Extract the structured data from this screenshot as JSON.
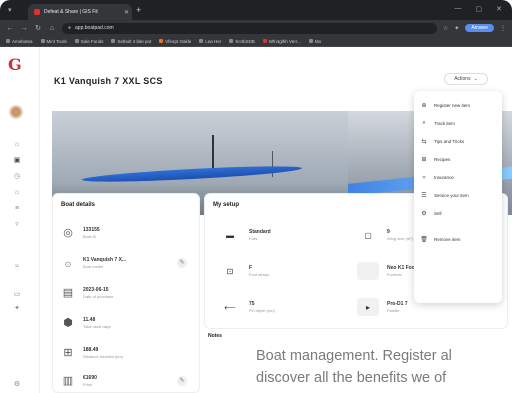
{
  "browser": {
    "tab_title": "Defeat & Share | GIS Fit",
    "url": "app.boatpad.com",
    "profile_label": "Amwee",
    "bookmarks": [
      "Amebotea",
      "Mint Tools",
      "Sole Funds",
      "Setbolt 4 bite pot",
      "Vfinrpt Oakle",
      "Lea Her",
      "ScrtkSDB",
      "Wfn4glhh Verr...",
      "Mo"
    ]
  },
  "sidebar": {
    "brand_logo": "G",
    "nav_icons": [
      "home-icon",
      "board-icon",
      "clock-icon",
      "bag-icon",
      "list-icon",
      "filter-icon",
      "wave-icon",
      "chat-icon",
      "star-icon",
      "settings-icon"
    ]
  },
  "page": {
    "title": "K1 Vanquish 7 XXL SCS",
    "actions_label": "Actions"
  },
  "boat_details": {
    "title": "Boat details",
    "rows": [
      {
        "icon": "gauge-icon",
        "value": "133155",
        "sub": "Boat ID"
      },
      {
        "icon": "fingerprint-icon",
        "value": "K1 Vanquish 7 X...",
        "sub": "Boat model"
      },
      {
        "icon": "calendar-icon",
        "value": "2023-06-15",
        "sub": "Date of purchase"
      },
      {
        "icon": "shield-icon",
        "value": "11.48",
        "sub": "Total used days"
      },
      {
        "icon": "ruler-icon",
        "value": "188.49",
        "sub": "Distance traveled (km)"
      },
      {
        "icon": "receipt-icon",
        "value": "€1690",
        "sub": "Price"
      }
    ]
  },
  "my_setup": {
    "title": "My setup",
    "items": [
      {
        "value": "Standard",
        "sub": "Foils",
        "color": "#ffffff"
      },
      {
        "value": "9",
        "sub": "Wing size (m²)",
        "color": "#ffffff"
      },
      {
        "value": "F",
        "sub": "Foot straps",
        "color": "#ffffff"
      },
      {
        "value": "Neo K1 Footrest with Car...",
        "sub": "Footrest",
        "color": "#f1f1f1"
      },
      {
        "value": "75",
        "sub": "Fin depth (cm)",
        "color": "#ffffff"
      },
      {
        "value": "Pro-D1 7",
        "sub": "Paddle",
        "color": "#f1f1f1"
      }
    ]
  },
  "notes_label": "Notes",
  "actions_menu": [
    {
      "icon": "plus-icon",
      "label": "Register new item"
    },
    {
      "icon": "search-icon",
      "label": "Track item"
    },
    {
      "icon": "share-icon",
      "label": "Tips and Tricks"
    },
    {
      "icon": "grid-icon",
      "label": "Recipes"
    },
    {
      "icon": "filter-icon",
      "label": "Insurance"
    },
    {
      "icon": "list-icon",
      "label": "Service your item"
    },
    {
      "icon": "gear-icon",
      "label": "Sell"
    },
    {
      "icon": "trash-icon",
      "label": "Remove item"
    }
  ],
  "overlay_caption": {
    "line1": "Boat management. Register al",
    "line2": "discover all the benefits we of"
  }
}
